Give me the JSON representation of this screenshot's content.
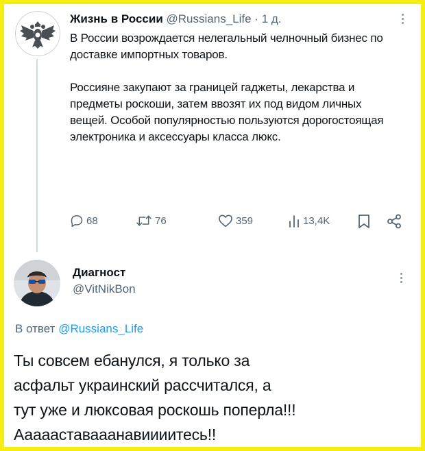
{
  "tweet1": {
    "author_name": "Жизнь в России",
    "author_handle": "@Russians_Life",
    "separator": "·",
    "time": "1 д.",
    "paragraph1": "В России возрождается нелегальный челночный бизнес по доставке импортных товаров.",
    "paragraph2": "Россияне закупают за границей гаджеты, лекарства и предметы роскоши, затем ввозят их под видом личных вещей. Особой популярностью пользуются дорогостоящая электроника и аксессуары класса люкс.",
    "replies": "68",
    "retweets": "76",
    "likes": "359",
    "views": "13,4K"
  },
  "tweet2": {
    "author_name": "Диагност",
    "author_handle": "@VitNikBon",
    "reply_prefix": "В ответ",
    "reply_handle": "@Russians_Life",
    "lines": [
      "Ты совсем ебанулся, я только за",
      "асфальт украинский рассчитался, а",
      "тут уже и люксовая роскошь поперла!!!",
      "Аааааставааанавиииитесь!!"
    ]
  },
  "colors": {
    "border": "#f6ee12",
    "link": "#1d9bf0",
    "secondary_text": "#536471"
  }
}
